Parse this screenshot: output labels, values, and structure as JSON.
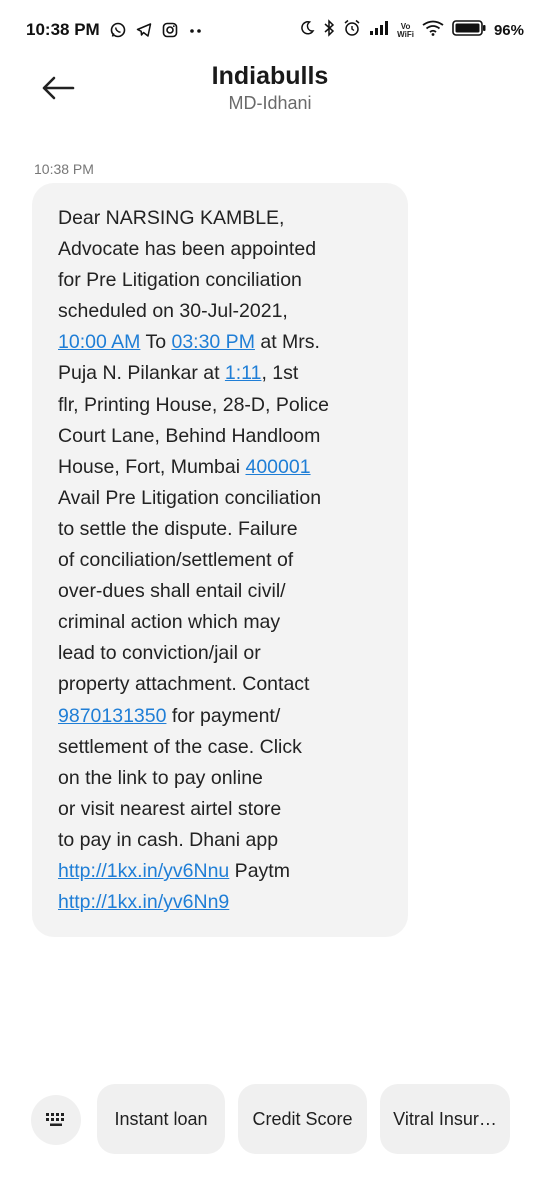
{
  "status_bar": {
    "time": "10:38 PM",
    "battery_percent": "96%",
    "vowifi_top": "Vo",
    "vowifi_bottom": "WiFi",
    "left_icons": [
      "whatsapp-icon",
      "telegram-icon",
      "instagram-icon",
      "dots-icon"
    ],
    "right_icons": [
      "moon-icon",
      "bluetooth-icon",
      "alarm-icon",
      "signal-icon",
      "vowifi-icon",
      "wifi-icon",
      "battery-icon"
    ]
  },
  "header": {
    "title": "Indiabulls",
    "subtitle": "MD-Idhani",
    "back_icon": "arrow-left-icon"
  },
  "message": {
    "time": "10:38 PM",
    "lines": [
      [
        {
          "t": "Dear NARSING KAMBLE,"
        }
      ],
      [
        {
          "t": "Advocate has been appointed"
        }
      ],
      [
        {
          "t": "for Pre Litigation conciliation"
        }
      ],
      [
        {
          "t": "scheduled on 30-Jul-2021,"
        }
      ],
      [
        {
          "t": "10:00 AM",
          "link": true
        },
        {
          "t": " To "
        },
        {
          "t": "03:30 PM",
          "link": true
        },
        {
          "t": " at Mrs."
        }
      ],
      [
        {
          "t": "Puja N. Pilankar at "
        },
        {
          "t": "1:11",
          "link": true
        },
        {
          "t": ", 1st"
        }
      ],
      [
        {
          "t": "flr, Printing House, 28-D, Police"
        }
      ],
      [
        {
          "t": "Court Lane, Behind Handloom"
        }
      ],
      [
        {
          "t": "House, Fort, Mumbai "
        },
        {
          "t": "400001",
          "link": true
        }
      ],
      [
        {
          "t": "Avail Pre Litigation conciliation"
        }
      ],
      [
        {
          "t": "to settle the dispute. Failure"
        }
      ],
      [
        {
          "t": "of conciliation/settlement of"
        }
      ],
      [
        {
          "t": "over-dues shall entail civil/"
        }
      ],
      [
        {
          "t": "criminal action which may"
        }
      ],
      [
        {
          "t": "lead to conviction/jail or"
        }
      ],
      [
        {
          "t": "property attachment. Contact"
        }
      ],
      [
        {
          "t": "9870131350",
          "link": true
        },
        {
          "t": " for payment/"
        }
      ],
      [
        {
          "t": "settlement of the case. Click"
        }
      ],
      [
        {
          "t": "on the link to pay online"
        }
      ],
      [
        {
          "t": "or visit nearest airtel store"
        }
      ],
      [
        {
          "t": "to pay in cash. Dhani app"
        }
      ],
      [
        {
          "t": "http://1kx.in/yv6Nnu",
          "link": true
        },
        {
          "t": " Paytm"
        }
      ],
      [
        {
          "t": "http://1kx.in/yv6Nn9",
          "link": true
        }
      ]
    ]
  },
  "suggestions": {
    "keyboard_icon": "keyboard-icon",
    "chips": [
      "Instant loan",
      "Credit Score",
      "Vitral Insur…"
    ]
  },
  "colors": {
    "link": "#1f7ed6",
    "bubble": "#f3f3f3",
    "chip": "#f0f0f0"
  }
}
